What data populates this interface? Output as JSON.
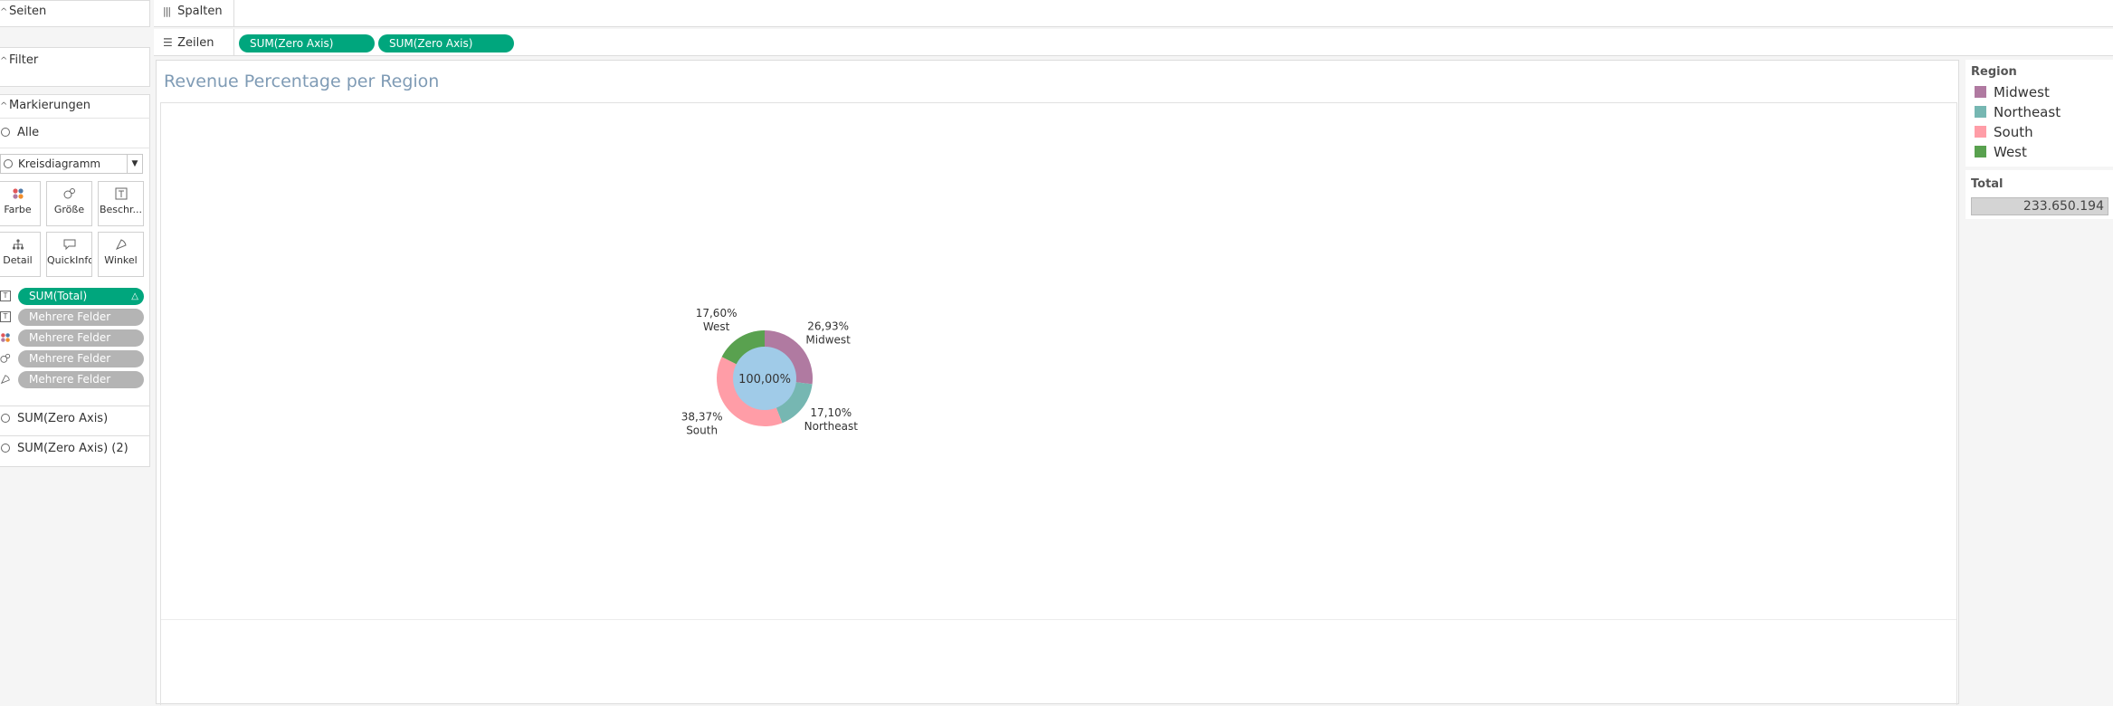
{
  "left": {
    "pages_label": "Seiten",
    "filter_label": "Filter",
    "marks_label": "Markierungen",
    "all_label": "Alle",
    "mark_type": "Kreisdiagramm",
    "buttons": {
      "color": "Farbe",
      "size": "Größe",
      "label": "Beschr...",
      "detail": "Detail",
      "tooltip": "QuickInfo",
      "angle": "Winkel"
    },
    "pills": [
      "SUM(Total)",
      "Mehrere Felder",
      "Mehrere Felder",
      "Mehrere Felder",
      "Mehrere Felder"
    ],
    "axis_items": [
      "SUM(Zero Axis)",
      "SUM(Zero Axis) (2)"
    ]
  },
  "shelves": {
    "columns_label": "Spalten",
    "rows_label": "Zeilen",
    "rows_pills": [
      "SUM(Zero Axis)",
      "SUM(Zero Axis)"
    ]
  },
  "view": {
    "title": "Revenue Percentage per Region"
  },
  "colors": {
    "Midwest": "#b07aa1",
    "Northeast": "#76b7b2",
    "South": "#ff9da7",
    "West": "#59a14f",
    "center": "#a0cbe8",
    "pill_green": "#00a67d"
  },
  "legend": {
    "title": "Region",
    "items": [
      "Midwest",
      "Northeast",
      "South",
      "West"
    ]
  },
  "total": {
    "title": "Total",
    "value": "233.650.194"
  },
  "chart_data": {
    "type": "pie",
    "categories": [
      "Midwest",
      "Northeast",
      "South",
      "West"
    ],
    "values": [
      26.93,
      17.1,
      38.37,
      17.6
    ],
    "labels": [
      "26,93%",
      "17,10%",
      "38,37%",
      "17,60%"
    ],
    "center_label": "100,00%"
  }
}
